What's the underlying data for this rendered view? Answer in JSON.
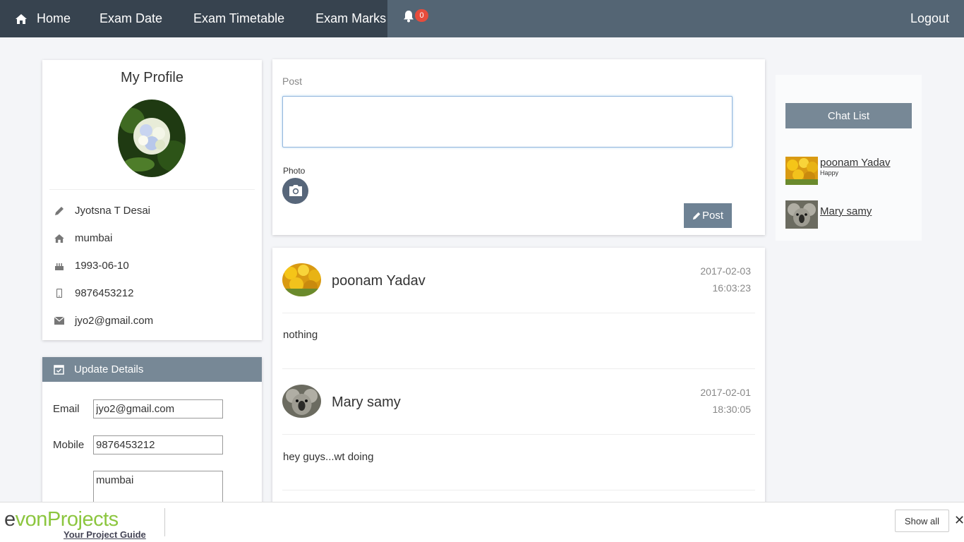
{
  "nav": {
    "home": "Home",
    "exam_date": "Exam Date",
    "exam_timetable": "Exam Timetable",
    "exam_marks": "Exam Marks",
    "notification_count": "0",
    "logout": "Logout"
  },
  "profile": {
    "title": "My Profile",
    "name": "Jyotsna T Desai",
    "city": "mumbai",
    "dob": "1993-06-10",
    "mobile": "9876453212",
    "email": "jyo2@gmail.com"
  },
  "update": {
    "heading": "Update Details",
    "email_label": "Email",
    "email_value": "jyo2@gmail.com",
    "mobile_label": "Mobile",
    "mobile_value": "9876453212",
    "address_value": "mumbai"
  },
  "post": {
    "label": "Post",
    "photo_label": "Photo",
    "button": "Post"
  },
  "feed": [
    {
      "name": "poonam Yadav",
      "date": "2017-02-03",
      "time": "16:03:23",
      "text": "nothing"
    },
    {
      "name": "Mary samy",
      "date": "2017-02-01",
      "time": "18:30:05",
      "text": "hey guys...wt doing"
    }
  ],
  "chat": {
    "button": "Chat List",
    "items": [
      {
        "name": "poonam Yadav",
        "status": "Happy"
      },
      {
        "name": "Mary samy",
        "status": ""
      }
    ]
  },
  "bottom": {
    "brand_dark": "e",
    "brand_green": "vonProjects",
    "brand_sub": "Your Project Guide",
    "show_all": "Show all",
    "close": "✕"
  }
}
